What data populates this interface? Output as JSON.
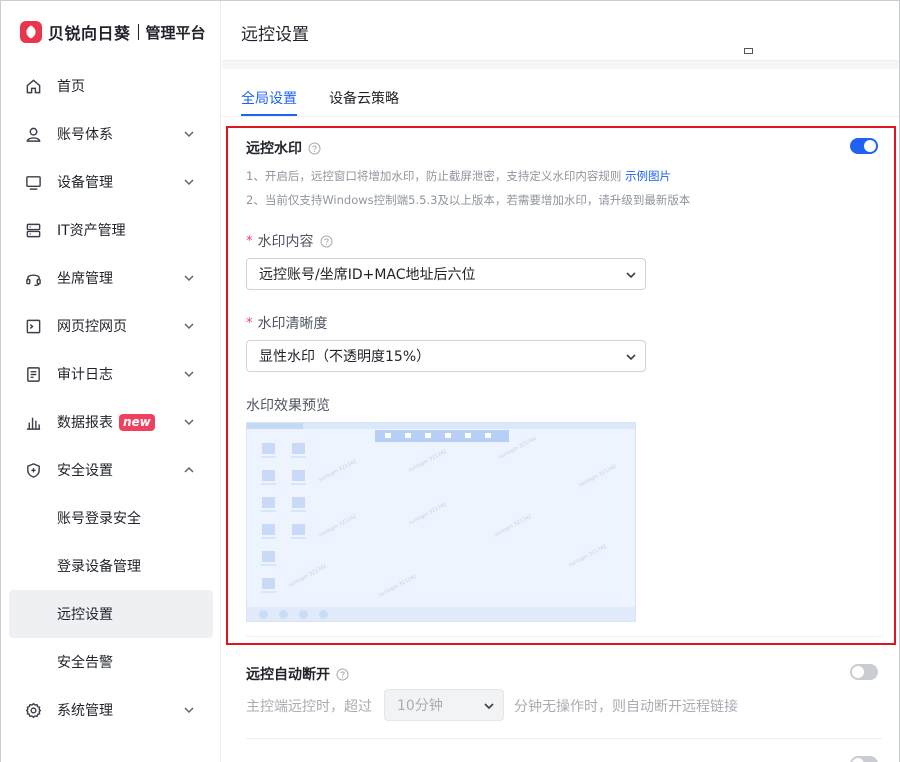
{
  "brand": {
    "name": "贝锐向日葵",
    "subtitle": "管理平台"
  },
  "sidebar": {
    "items": [
      {
        "label": "首页",
        "icon": "home-icon",
        "chevron": false
      },
      {
        "label": "账号体系",
        "icon": "user-icon",
        "chevron": "down"
      },
      {
        "label": "设备管理",
        "icon": "monitor-icon",
        "chevron": "down"
      },
      {
        "label": "IT资产管理",
        "icon": "server-icon",
        "chevron": false
      },
      {
        "label": "坐席管理",
        "icon": "headset-icon",
        "chevron": "down"
      },
      {
        "label": "网页控网页",
        "icon": "terminal-icon",
        "chevron": "down"
      },
      {
        "label": "审计日志",
        "icon": "document-icon",
        "chevron": "down"
      },
      {
        "label": "数据报表",
        "icon": "bar-chart-icon",
        "chevron": "down",
        "badge": "new"
      },
      {
        "label": "安全设置",
        "icon": "shield-icon",
        "chevron": "up"
      },
      {
        "label": "系统管理",
        "icon": "gear-icon",
        "chevron": "down"
      }
    ],
    "sub_items": [
      {
        "label": "账号登录安全",
        "active": false
      },
      {
        "label": "登录设备管理",
        "active": false
      },
      {
        "label": "远控设置",
        "active": true
      },
      {
        "label": "安全告警",
        "active": false
      }
    ]
  },
  "header": {
    "title": "远控设置"
  },
  "tabs": [
    {
      "label": "全局设置",
      "active": true
    },
    {
      "label": "设备云策略",
      "active": false
    }
  ],
  "watermark": {
    "title": "远控水印",
    "enabled": true,
    "note1": "1、开启后，远控窗口将增加水印，防止截屏泄密，支持定义水印内容规则",
    "note1_link": "示例图片",
    "note2": "2、当前仅支持Windows控制端5.5.3及以上版本，若需要增加水印，请升级到最新版本",
    "content_label": "水印内容",
    "content_value": "远控账号/坐席ID+MAC地址后六位",
    "clarity_label": "水印清晰度",
    "clarity_value": "显性水印（不透明度15%）",
    "preview_label": "水印效果预览",
    "preview_watermark_text": "sunlogin 321342"
  },
  "auto_disconnect": {
    "title": "远控自动断开",
    "enabled": false,
    "prefix": "主控端远控时，超过",
    "select_value": "10分钟",
    "suffix": "分钟无操作时，则自动断开远程链接"
  },
  "colors": {
    "accent": "#2162f2",
    "highlight": "#e0161e",
    "badge": "#f0405f"
  }
}
